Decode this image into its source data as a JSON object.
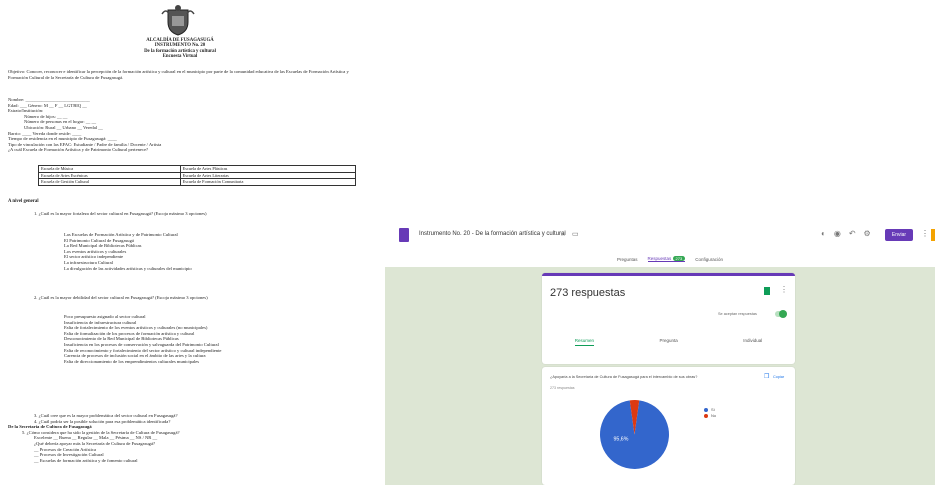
{
  "document": {
    "header_lines": [
      "ALCALDÍA DE FUSAGASUGÁ",
      "INSTRUMENTO No. 20",
      "De la formación artística y cultural",
      "Encuesta Virtual"
    ],
    "objective": "Objetivo: Conocer, reconocer e identificar la percepción de la formación artística y cultural en el municipio por parte de la comunidad educativa de las Escuelas de Formación Artística y Formación Cultural de la Secretaría de Cultura de Fusagasugá.",
    "fields": [
      "Nombre: ____________________________",
      "Edad: ___ Género: M __ F __ LGTBIQ __",
      "Estrato/Institución:",
      "Número de hijos: __ __",
      "Número de personas en el hogar: __ __",
      "Ubicación: Rural __ Urbano __ Veredal __",
      "Barrio: ____ Vereda donde reside: ____",
      "Tiempo de residencia en el municipio de Fusagasugá: ____",
      "Tipo de vinculación con las EFAC: Estudiante / Padre de familia / Docente / Artista",
      "¿A cuál Escuela de Formación Artística y de Patrimonio Cultural pertenece?"
    ],
    "table_rows": [
      [
        "Escuela de Música",
        "Escuela de Artes Plásticas"
      ],
      [
        "Escuela de Artes Escénicas",
        "Escuela de Artes Literarias"
      ],
      [
        "Escuela de Gestión Cultural",
        "Escuela de Formación Comunitaria"
      ]
    ],
    "section_title": "A nivel general",
    "q1": "1. ¿Cuál es la mayor fortaleza del sector cultural en Fusagasugá? (Escoja máximo 3 opciones)",
    "q1_options": [
      "Las Escuelas de Formación Artística y de Patrimonio Cultural",
      "El Patrimonio Cultural de Fusagasugá",
      "La Red Municipal de Bibliotecas Públicas",
      "Los eventos artísticos y culturales",
      "El sector artístico independiente",
      "La infraestructura Cultural",
      "La divulgación de las actividades artísticas y culturales del municipio"
    ],
    "q2": "2. ¿Cuál es la mayor debilidad del sector cultural en Fusagasugá? (Escoja máximo 3 opciones)",
    "q2_options": [
      "Poco presupuesto asignado al sector cultural",
      "Insuficiencia de infraestructura cultural",
      "Falta de fortalecimiento de los eventos artísticos y culturales (no municipales)",
      "Falta de formalización de los procesos de formación artística y cultural",
      "Desconocimiento de la Red Municipal de Bibliotecas Públicas",
      "Insuficiencia en los procesos de conservación y salvaguarda del Patrimonio Cultural",
      "Falta de reconocimiento y fortalecimiento del sector artístico y cultural independiente",
      "Carencia de procesos de inclusión social en el ámbito de las artes y la cultura",
      "Falta de direccionamiento de los emprendimientos culturales municipales"
    ],
    "footer_lines": [
      "3. ¿Cuál cree que es la mayor problemática del sector cultural en Fusagasugá?",
      "4. ¿Cuál podría ser la posible solución para esa problemática identificada?",
      "De la Secretaría de Cultura de Fusagasugá",
      "5. ¿Cómo considera que ha sido la gestión de la Secretaría de Cultura de Fusagasugá?",
      "Excelente __ Buena __ Regular __ Mala __ Pésima __ NS / NR __",
      "¿Qué debería apoyar más la Secretaría de Cultura de Fusagasugá?",
      "__ Procesos de Creación Artística",
      "__ Procesos de Investigación Cultural",
      "__ Escuelas de formación artística y de fomento cultural"
    ]
  },
  "forms": {
    "title": "Instrumento No. 20 - De la formación artística y cultural",
    "send_label": "Enviar",
    "tabs": [
      {
        "label": "Preguntas"
      },
      {
        "label": "Respuestas",
        "badge": "273"
      },
      {
        "label": "Configuración"
      }
    ],
    "response_count": "273 respuestas",
    "accepting_label": "Se aceptan respuestas",
    "subtabs": [
      "Resumen",
      "Pregunta",
      "Individual"
    ],
    "question": "¿Apoyaría a la Secretaría de Cultura de Fusagasugá para el intercambio de sus obras?",
    "question_count": "273 respuestas",
    "copy_label": "Copiar",
    "pie_label": "95,6%"
  },
  "chart_data": {
    "type": "pie",
    "categories": [
      "Sí",
      "No"
    ],
    "values": [
      95.6,
      4.4
    ],
    "colors": [
      "#3366cc",
      "#dc3912"
    ],
    "legend_position": "right"
  },
  "icons": {
    "crest": "coat-of-arms-icon",
    "form": "forms-icon",
    "star": "star-icon",
    "folder": "folder-icon",
    "sheets": "sheets-icon",
    "more": "more-vert-icon",
    "copy": "copy-icon"
  }
}
